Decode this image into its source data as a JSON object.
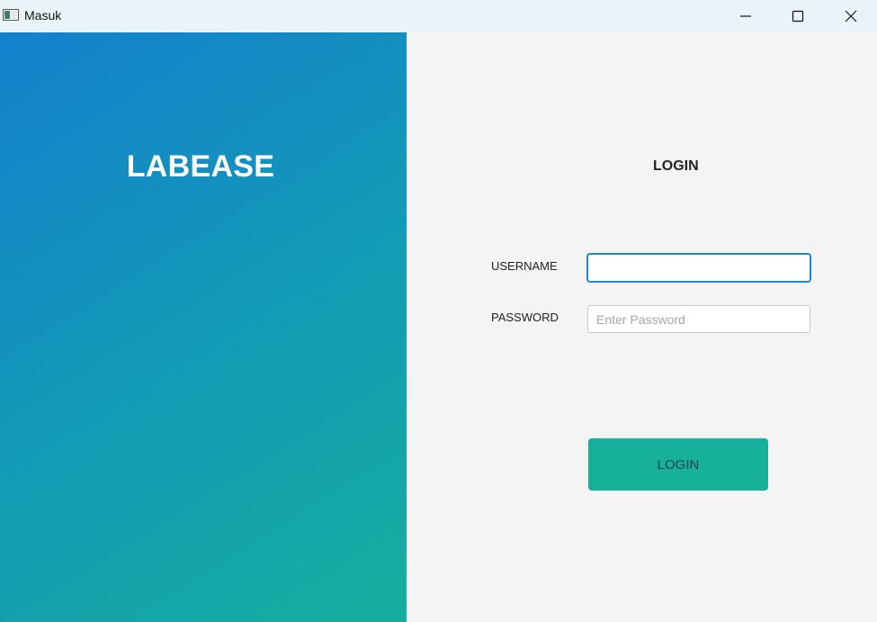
{
  "window": {
    "title": "Masuk"
  },
  "brand": {
    "name": "LABEASE"
  },
  "login_form": {
    "heading": "LOGIN",
    "username_label": "USERNAME",
    "username_value": "",
    "password_label": "PASSWORD",
    "password_placeholder": "Enter Password",
    "submit_label": "LOGIN"
  },
  "colors": {
    "gradient_start": "#1480cd",
    "gradient_end": "#16ae9e",
    "button": "#17b09b",
    "focus_border": "#1a8ad6"
  },
  "icons": [
    "app-icon",
    "minimize-icon",
    "maximize-icon",
    "close-icon"
  ]
}
